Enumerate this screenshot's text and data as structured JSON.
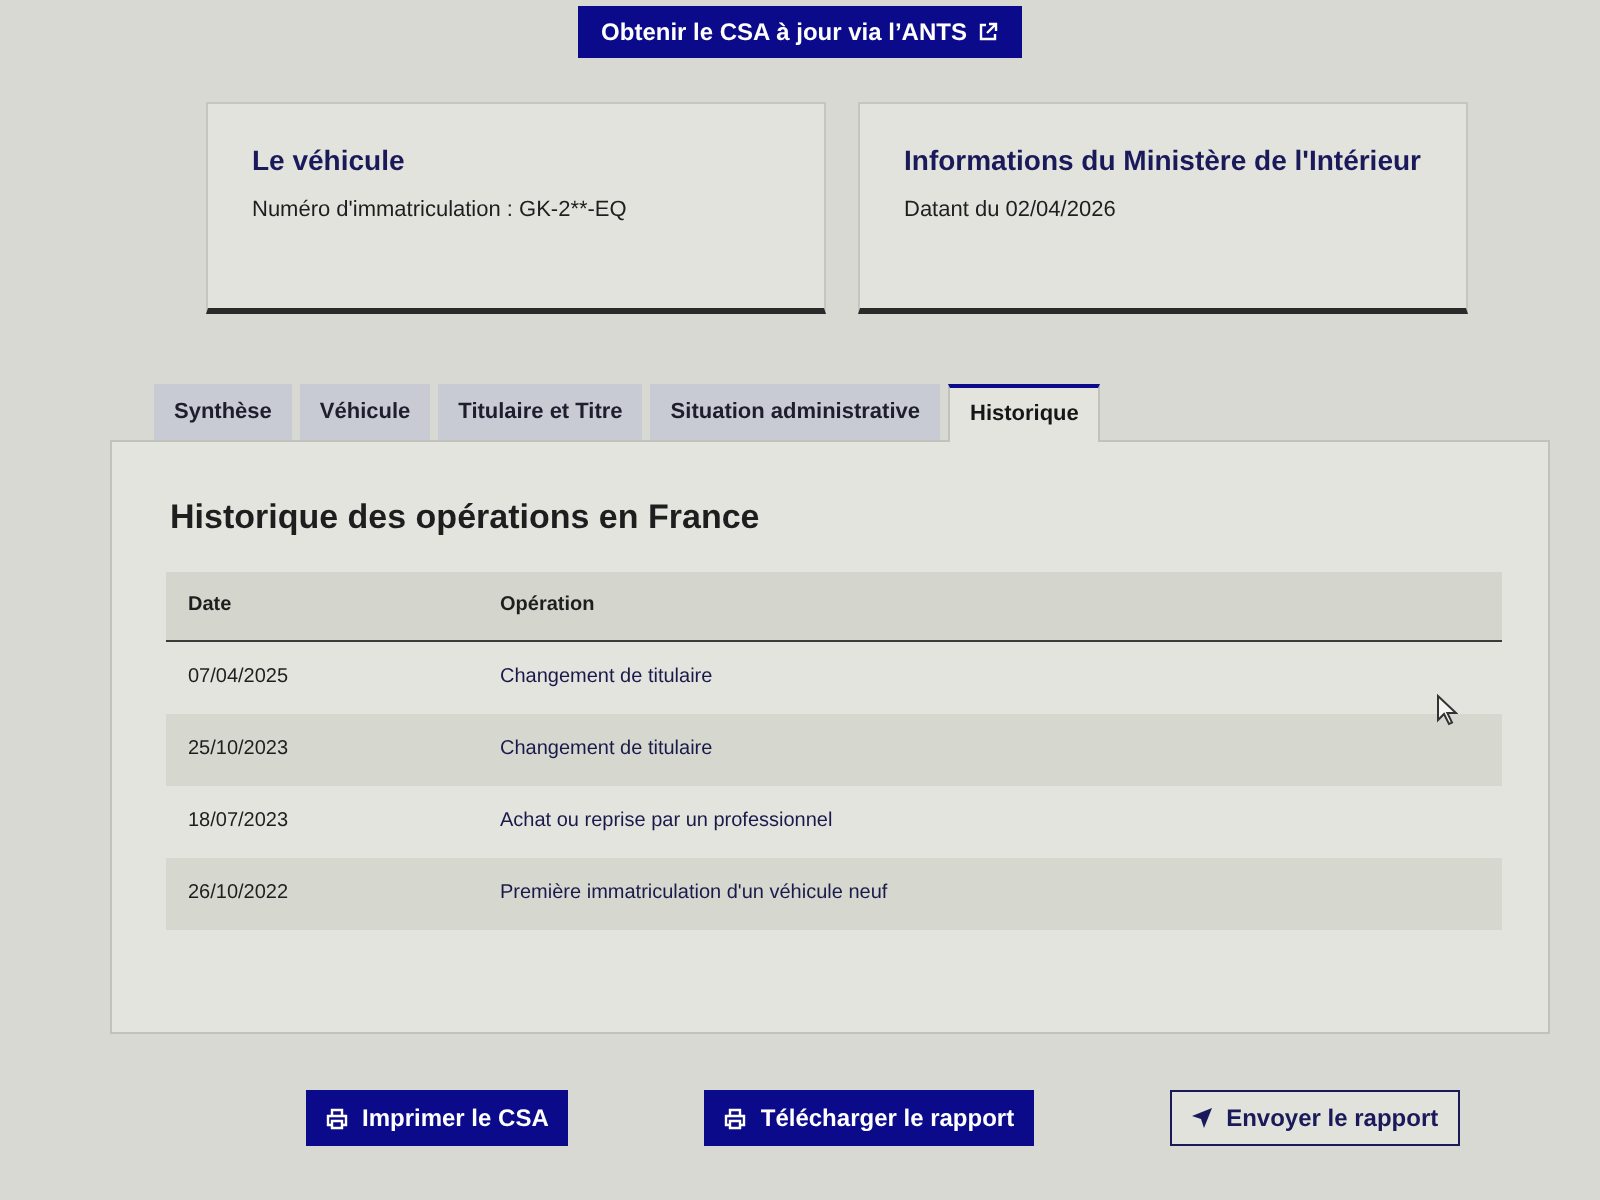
{
  "top_link": {
    "label": "Obtenir le CSA à jour via l’ANTS"
  },
  "cards": [
    {
      "title": "Le véhicule",
      "text": "Numéro d'immatriculation : GK-2**-EQ"
    },
    {
      "title": "Informations du Ministère de l'Intérieur",
      "text": "Datant du 02/04/2026"
    }
  ],
  "tabs": [
    {
      "label": "Synthèse",
      "selected": false
    },
    {
      "label": "Véhicule",
      "selected": false
    },
    {
      "label": "Titulaire et Titre",
      "selected": false
    },
    {
      "label": "Situation administrative",
      "selected": false
    },
    {
      "label": "Historique",
      "selected": true
    }
  ],
  "history": {
    "title": "Historique des opérations en France",
    "columns": [
      "Date",
      "Opération"
    ],
    "rows": [
      {
        "date": "07/04/2025",
        "operation": "Changement de titulaire"
      },
      {
        "date": "25/10/2023",
        "operation": "Changement de titulaire"
      },
      {
        "date": "18/07/2023",
        "operation": "Achat ou reprise par un professionnel"
      },
      {
        "date": "26/10/2022",
        "operation": "Première immatriculation d'un véhicule neuf"
      }
    ]
  },
  "actions": [
    {
      "label": "Imprimer le CSA",
      "kind": "print"
    },
    {
      "label": "Télécharger le rapport",
      "kind": "print"
    },
    {
      "label": "Envoyer le rapport",
      "kind": "send"
    }
  ]
}
